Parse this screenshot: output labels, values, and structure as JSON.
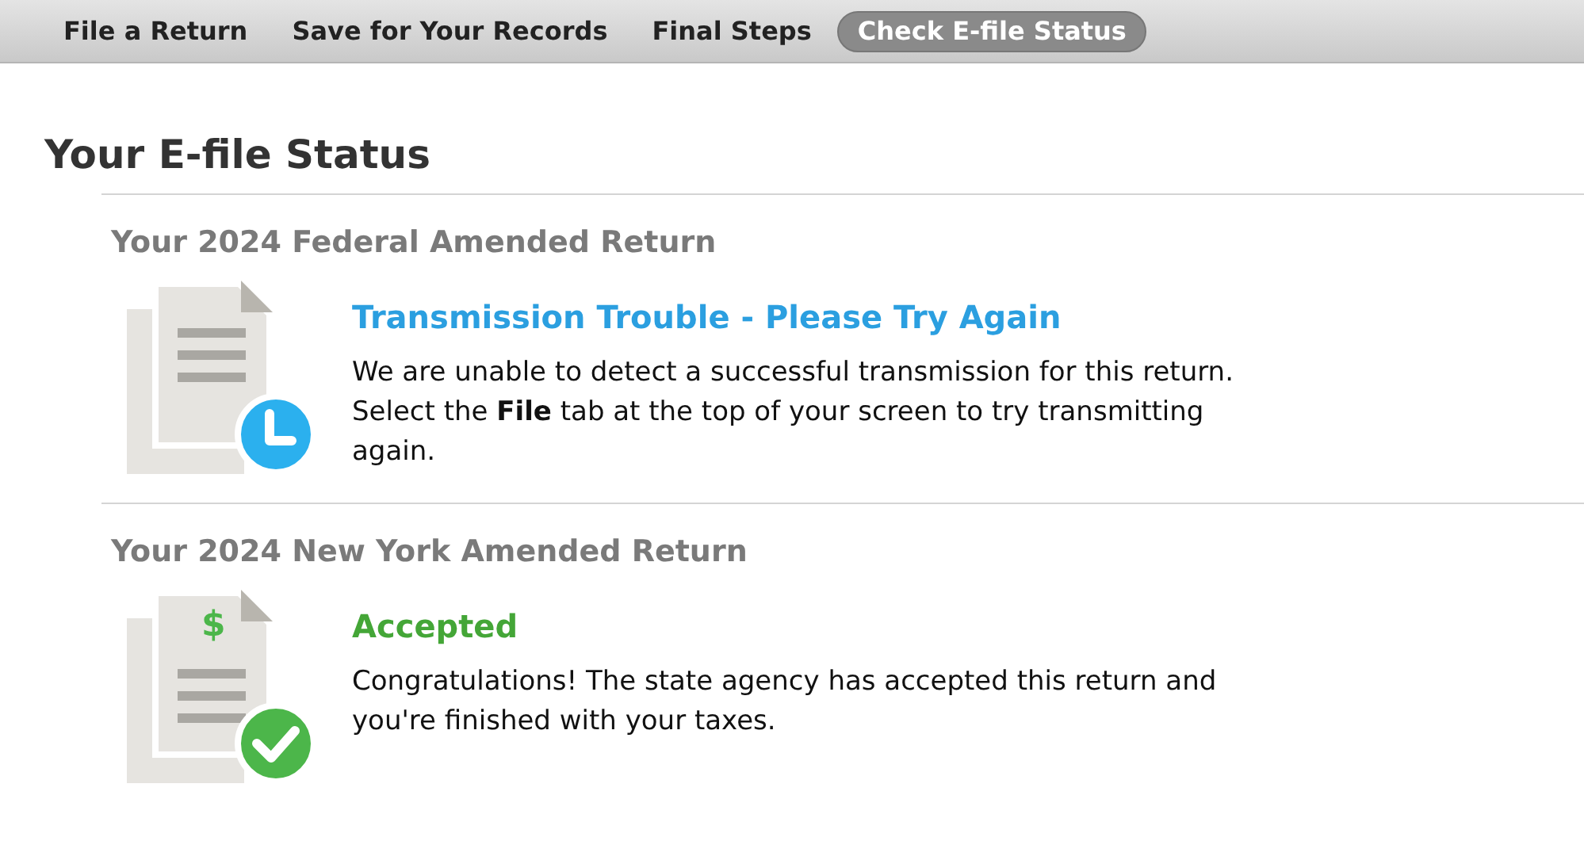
{
  "tabs": [
    {
      "label": "File a Return",
      "selected": false
    },
    {
      "label": "Save for Your Records",
      "selected": false
    },
    {
      "label": "Final Steps",
      "selected": false
    },
    {
      "label": "Check E-file Status",
      "selected": true
    }
  ],
  "page_title": "Your E-file Status",
  "returns": [
    {
      "heading": "Your 2024 Federal Amended Return",
      "kind": "pending",
      "status": "Transmission Trouble - Please Try Again",
      "message": "We are unable to detect a successful transmission for this return. Select the **File** tab at the top of your screen to try transmitting again."
    },
    {
      "heading": "Your 2024 New York Amended Return",
      "kind": "accepted",
      "icon_symbol": "$",
      "status": "Accepted",
      "message": "Congratulations! The state agency has accepted this return and you're finished with your taxes."
    }
  ]
}
